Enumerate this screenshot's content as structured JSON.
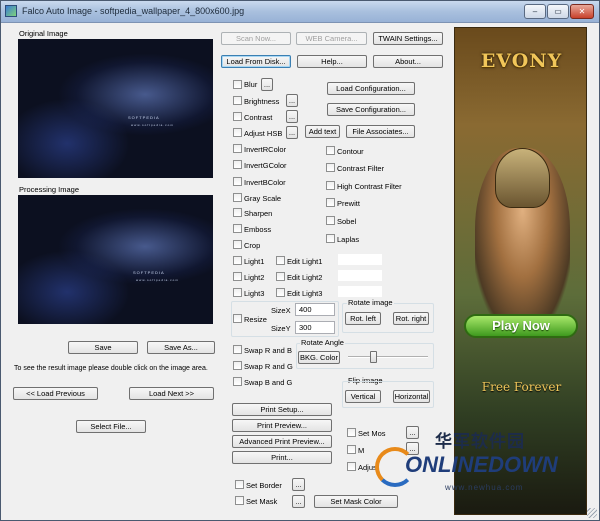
{
  "window": {
    "title": "Falco Auto Image - softpedia_wallpaper_4_800x600.jpg",
    "min": "‒",
    "max": "▭",
    "close": "✕"
  },
  "images": {
    "original_label": "Original Image",
    "processing_label": "Processing Image",
    "watermark": "SOFTPEDIA",
    "watermark_sub": "www.softpedia.com"
  },
  "buttons": {
    "scan_now": "Scan Now...",
    "web_camera": "WEB Camera...",
    "twain_settings": "TWAIN Settings...",
    "load_from_disk": "Load From Disk...",
    "help": "Help...",
    "about": "About...",
    "load_configuration": "Load Configuration...",
    "save_configuration": "Save Configuration...",
    "add_text": "Add text",
    "file_associates": "File Associates...",
    "save": "Save",
    "save_as": "Save As...",
    "load_previous": "<< Load Previous",
    "load_next": "Load Next >>",
    "select_file": "Select File...",
    "rot_left": "Rot. left",
    "rot_right": "Rot. right",
    "bkg_color": "BKG. Color",
    "vertical": "Vertical",
    "horizontal": "Horizontal",
    "print_setup": "Print Setup...",
    "print_preview": "Print Preview...",
    "advanced_print_preview": "Advanced Print Preview...",
    "print": "Print...",
    "set_mask_color": "Set Mask Color",
    "ellipsis": "..."
  },
  "hint": "To see the result image please double click on the image area.",
  "filters_col1": [
    "Blur",
    "Brightness",
    "Contrast",
    "Adjust HSB",
    "InvertRColor",
    "InvertGColor",
    "InvertBColor",
    "Gray Scale",
    "Sharpen",
    "Emboss",
    "Crop",
    "Light1",
    "Light2",
    "Light3"
  ],
  "filters_col2": [
    "Contour",
    "Contrast Filter",
    "High Contrast Filter",
    "Prewitt",
    "Sobel",
    "Laplas"
  ],
  "edit_lights": [
    "Edit Light1",
    "Edit Light2",
    "Edit Light3"
  ],
  "resize": {
    "label": "Resize",
    "sizex_label": "SizeX",
    "sizex": "400",
    "sizey_label": "SizeY",
    "sizey": "300"
  },
  "rotate_image_label": "Rotate image",
  "rotate_angle_label": "Rotate Angle",
  "rotate_angle_level": 0.3,
  "flip_image_label": "Flip image",
  "swaps": [
    "Swap R and B",
    "Swap R and G",
    "Swap B and G"
  ],
  "set_mos_label": "Set Mos",
  "m_label": "M",
  "adjust_label": "Adjust",
  "set_border_label": "Set Border",
  "set_mask_label": "Set Mask",
  "ad": {
    "logo": "EVONY",
    "play": "Play Now",
    "free": "Free Forever"
  },
  "site_watermark": {
    "cn": "华军软件园",
    "brand": "ONLINEDOWN",
    "url": "www.newhua.com"
  }
}
